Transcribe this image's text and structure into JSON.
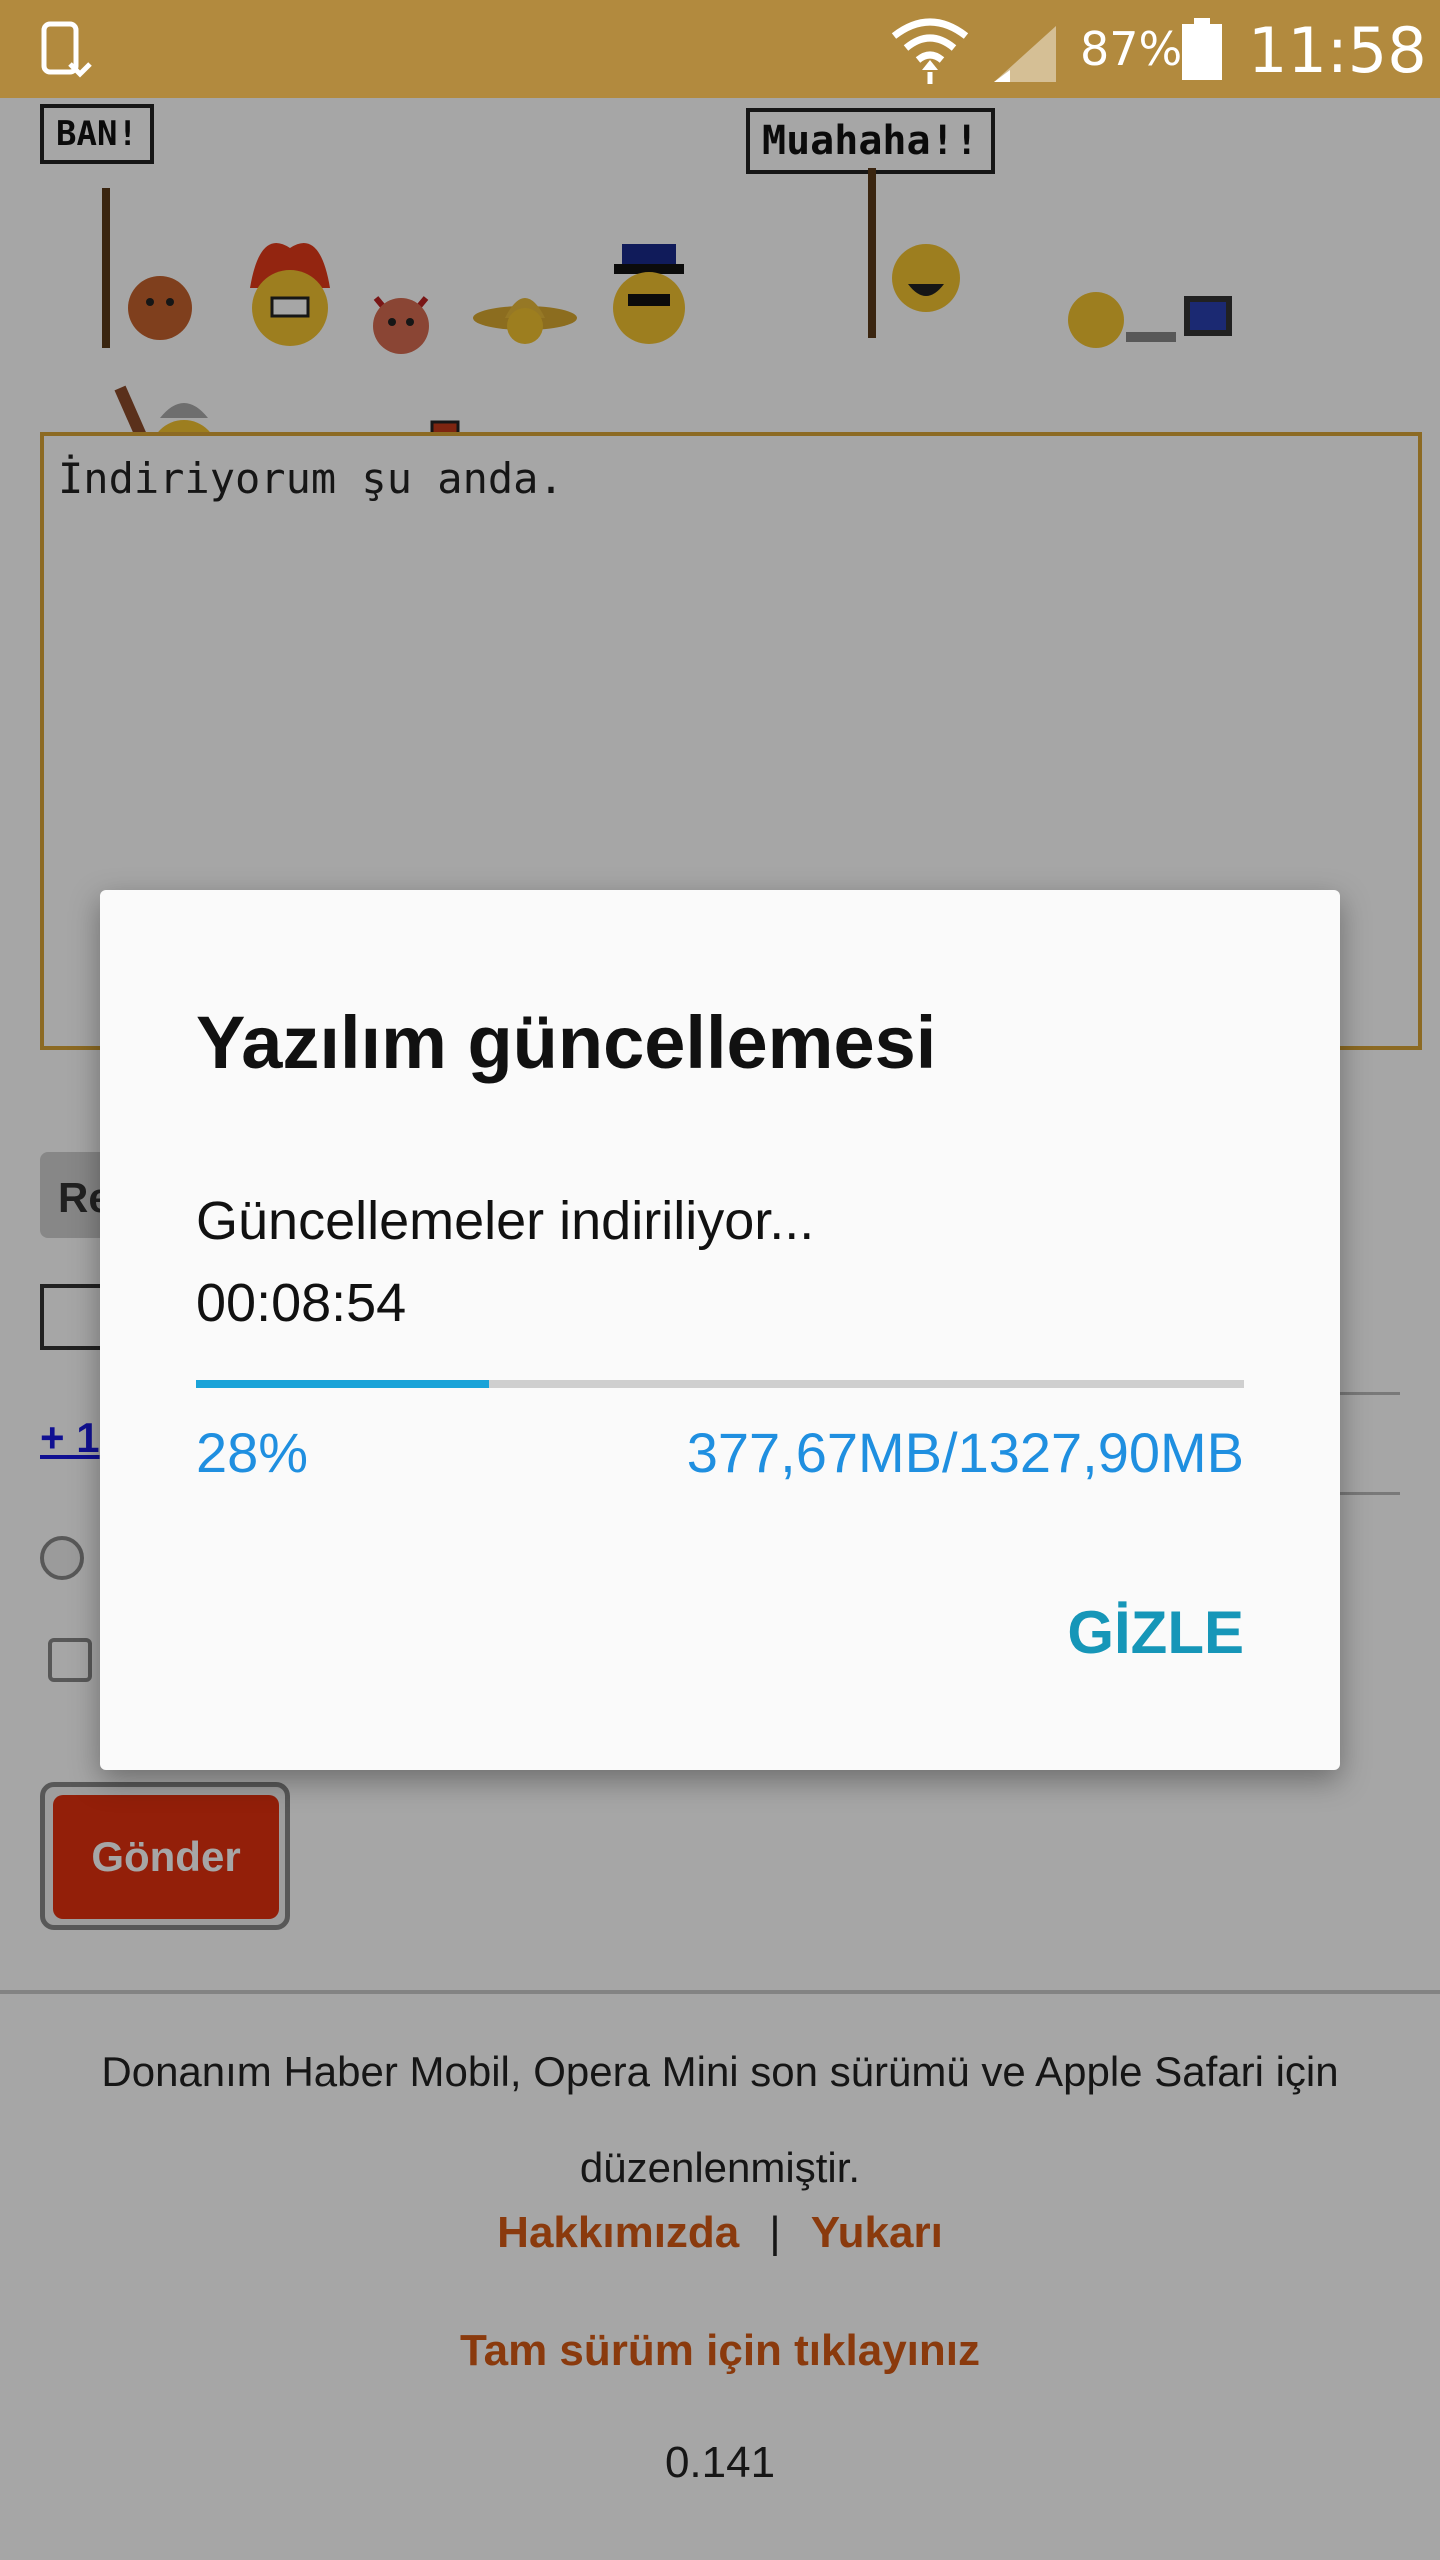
{
  "status_bar": {
    "battery_percent": "87%",
    "time": "11:58",
    "icons": [
      "sim-card-icon",
      "wifi-icon",
      "signal-icon",
      "battery-icon"
    ]
  },
  "page": {
    "signs": {
      "ban": "BAN!",
      "muahaha": "Muahaha!!"
    },
    "message_text": "İndiriyorum şu anda.",
    "partial_button": "Re",
    "partial_link": "+ 1",
    "send_button": "Gönder",
    "footer": {
      "text": "Donanım Haber Mobil, Opera Mini son sürümü ve Apple Safari için düzenlenmiştir.",
      "about_link": "Hakkımızda",
      "separator": "|",
      "top_link": "Yukarı",
      "full_version_link": "Tam sürüm için tıklayınız",
      "version": "0.141"
    }
  },
  "dialog": {
    "title": "Yazılım güncellemesi",
    "message": "Güncellemeler indiriliyor...",
    "elapsed": "00:08:54",
    "progress": 0.28,
    "percent_label": "28%",
    "size_label": "377,67MB/1327,90MB",
    "hide_button": "GİZLE"
  },
  "colors": {
    "status_bar": "#b28a3e",
    "accent_progress": "#1aa3d8",
    "percent_text": "#1f8fe0",
    "hide_button": "#1696b8",
    "send_button": "#e2300f",
    "footer_link": "#d55a14"
  }
}
